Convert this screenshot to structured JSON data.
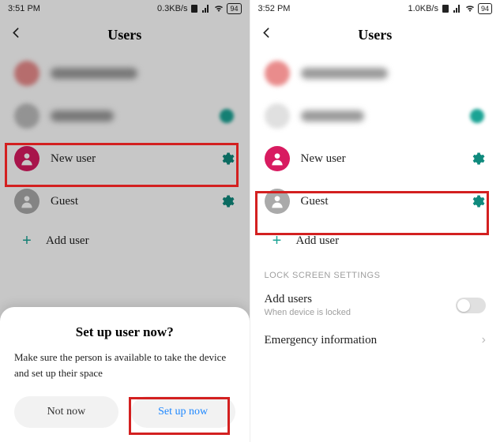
{
  "left": {
    "statusbar": {
      "time": "3:51 PM",
      "net": "0.3KB/s",
      "battery": "94"
    },
    "header": {
      "title": "Users"
    },
    "rows": {
      "new_user": "New user",
      "guest": "Guest",
      "add_user": "Add user"
    },
    "sheet": {
      "title": "Set up user now?",
      "message": "Make sure the person is available to take the device and set up their space",
      "btn_not_now": "Not now",
      "btn_set_up": "Set up now"
    }
  },
  "right": {
    "statusbar": {
      "time": "3:52 PM",
      "net": "1.0KB/s",
      "battery": "94"
    },
    "header": {
      "title": "Users"
    },
    "rows": {
      "new_user": "New user",
      "guest": "Guest",
      "add_user": "Add user"
    },
    "section_label": "LOCK SCREEN SETTINGS",
    "add_users_title": "Add users",
    "add_users_sub": "When device is locked",
    "emergency": "Emergency information"
  },
  "colors": {
    "highlight": "#d32020",
    "accent_teal": "#0f8a7d",
    "accent_pink": "#d81b60",
    "link_blue": "#1e88ff"
  }
}
